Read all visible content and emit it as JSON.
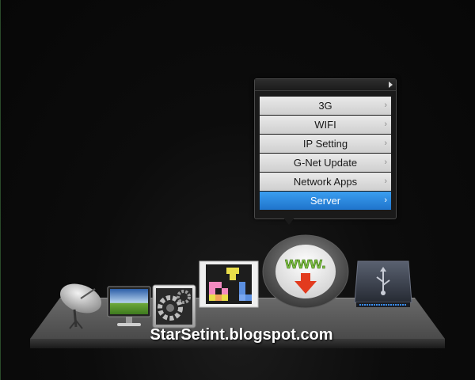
{
  "menu": {
    "items": [
      {
        "label": "3G",
        "selected": false
      },
      {
        "label": "WIFI",
        "selected": false
      },
      {
        "label": "IP Setting",
        "selected": false
      },
      {
        "label": "G-Net Update",
        "selected": false
      },
      {
        "label": "Network Apps",
        "selected": false
      },
      {
        "label": "Server",
        "selected": true
      }
    ],
    "chevron": "›"
  },
  "shelf_icons": [
    {
      "name": "satellite-dish-icon"
    },
    {
      "name": "monitor-icon"
    },
    {
      "name": "settings-gear-icon"
    },
    {
      "name": "apps-blocks-icon"
    },
    {
      "name": "network-www-icon",
      "label": "www.",
      "selected": true
    },
    {
      "name": "usb-drive-icon"
    }
  ],
  "watermark": "StarSetint.blogspot.com",
  "colors": {
    "selection_blue": "#2a88e0",
    "menu_item_bg": "#dcdcdc",
    "www_green": "#7dc242",
    "download_red": "#e23b1e"
  }
}
